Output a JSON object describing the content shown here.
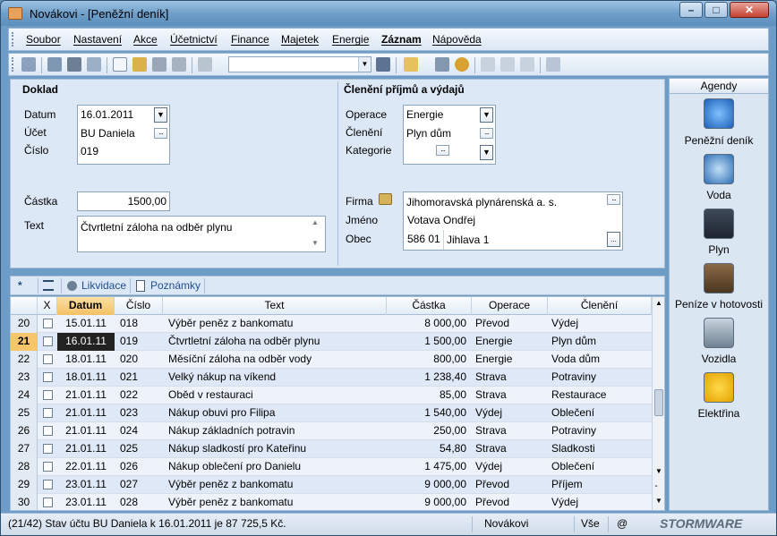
{
  "window": {
    "title": "Novákovi - [Peněžní deník]"
  },
  "menu": [
    "Soubor",
    "Nastavení",
    "Akce",
    "Účetnictví",
    "Finance",
    "Majetek",
    "Energie",
    "Záznam",
    "Nápověda"
  ],
  "menu_active": "Záznam",
  "doklad": {
    "group_title": "Doklad",
    "datum_label": "Datum",
    "datum_value": "16.01.2011",
    "ucet_label": "Účet",
    "ucet_value": "BU Daniela",
    "cislo_label": "Číslo",
    "cislo_value": "019",
    "castka_label": "Částka",
    "castka_value": "1500,00",
    "text_label": "Text",
    "text_value": "Čtvrtletní záloha na odběr plynu"
  },
  "cleneni": {
    "group_title": "Členění příjmů a výdajů",
    "operace_label": "Operace",
    "operace_value": "Energie",
    "cleneni_label": "Členění",
    "cleneni_value": "Plyn dům",
    "kategorie_label": "Kategorie",
    "kategorie_value": "",
    "firma_label": "Firma",
    "firma_value": "Jihomoravská plynárenská a. s.",
    "jmeno_label": "Jméno",
    "jmeno_value": "Votava Ondřej",
    "obec_label": "Obec",
    "psc_value": "586 01",
    "obec_value": "Jihlava 1"
  },
  "tabs": {
    "star": "*",
    "likvidace": "Likvidace",
    "poznamky": "Poznámky"
  },
  "table": {
    "columns": [
      "X",
      "Datum",
      "Číslo",
      "Text",
      "Částka",
      "Operace",
      "Členění"
    ],
    "rows": [
      {
        "n": "20",
        "datum": "15.01.11",
        "cislo": "018",
        "text": "Výběr peněz z bankomatu",
        "castka": "8 000,00",
        "operace": "Převod",
        "cleneni": "Výdej"
      },
      {
        "n": "21",
        "datum": "16.01.11",
        "cislo": "019",
        "text": "Čtvrtletní záloha na odběr plynu",
        "castka": "1 500,00",
        "operace": "Energie",
        "cleneni": "Plyn dům"
      },
      {
        "n": "22",
        "datum": "18.01.11",
        "cislo": "020",
        "text": "Měsíční záloha na odběr vody",
        "castka": "800,00",
        "operace": "Energie",
        "cleneni": "Voda dům"
      },
      {
        "n": "23",
        "datum": "18.01.11",
        "cislo": "021",
        "text": "Velký nákup na víkend",
        "castka": "1 238,40",
        "operace": "Strava",
        "cleneni": "Potraviny"
      },
      {
        "n": "24",
        "datum": "21.01.11",
        "cislo": "022",
        "text": "Oběd v restauraci",
        "castka": "85,00",
        "operace": "Strava",
        "cleneni": "Restaurace"
      },
      {
        "n": "25",
        "datum": "21.01.11",
        "cislo": "023",
        "text": "Nákup obuvi pro Filipa",
        "castka": "1 540,00",
        "operace": "Výdej",
        "cleneni": "Oblečení"
      },
      {
        "n": "26",
        "datum": "21.01.11",
        "cislo": "024",
        "text": "Nákup základních potravin",
        "castka": "250,00",
        "operace": "Strava",
        "cleneni": "Potraviny"
      },
      {
        "n": "27",
        "datum": "21.01.11",
        "cislo": "025",
        "text": "Nákup sladkostí pro Kateřinu",
        "castka": "54,80",
        "operace": "Strava",
        "cleneni": "Sladkosti"
      },
      {
        "n": "28",
        "datum": "22.01.11",
        "cislo": "026",
        "text": "Nákup oblečení pro Danielu",
        "castka": "1 475,00",
        "operace": "Výdej",
        "cleneni": "Oblečení"
      },
      {
        "n": "29",
        "datum": "23.01.11",
        "cislo": "027",
        "text": "Výběr peněz z bankomatu",
        "castka": "9 000,00",
        "operace": "Převod",
        "cleneni": "Příjem"
      },
      {
        "n": "30",
        "datum": "23.01.11",
        "cislo": "028",
        "text": "Výběr peněz z bankomatu",
        "castka": "9 000,00",
        "operace": "Převod",
        "cleneni": "Výdej"
      }
    ],
    "selected_row": "21"
  },
  "agendy": {
    "header": "Agendy",
    "items": [
      {
        "label": "Peněžní deník",
        "icon": "money-journal-icon"
      },
      {
        "label": "Voda",
        "icon": "water-drop-icon"
      },
      {
        "label": "Plyn",
        "icon": "gas-meter-icon"
      },
      {
        "label": "Peníze v hotovosti",
        "icon": "cash-icon"
      },
      {
        "label": "Vozidla",
        "icon": "car-icon"
      },
      {
        "label": "Elektřina",
        "icon": "plug-icon"
      }
    ]
  },
  "status": {
    "main": "(21/42) Stav účtu BU Daniela  k 16.01.2011 je 87 725,5 Kč.",
    "company": "Novákovi",
    "filter": "Vše",
    "at": "@",
    "brand": "STORMWARE"
  },
  "colors": {
    "selected_row": "#f7c56a",
    "row_even": "#eef3fb",
    "row_odd": "#dfe8f6",
    "form_bg": "#dde8f7"
  }
}
